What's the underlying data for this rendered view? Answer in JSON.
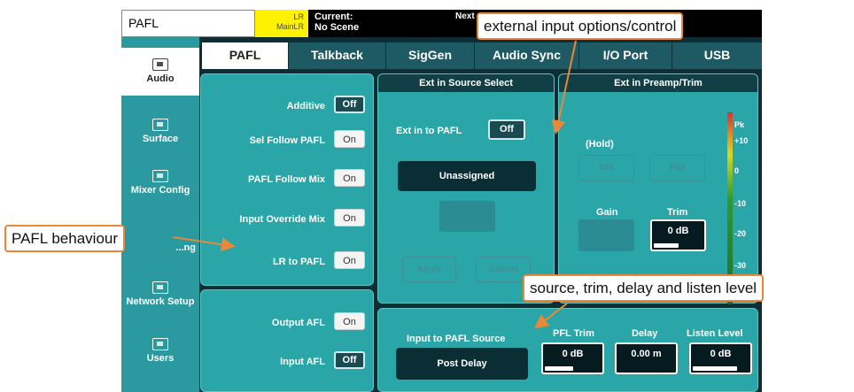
{
  "topbar": {
    "selected_name": "PAFL",
    "bus_line1": "LR",
    "bus_line2": "MainLR",
    "current_label": "Current:",
    "current_scene": "No Scene",
    "next_label": "Next"
  },
  "nav": [
    {
      "label": "Audio",
      "active": true
    },
    {
      "label": "Surface"
    },
    {
      "label": "Mixer Config"
    },
    {
      "label": "...ng"
    },
    {
      "label": "Network Setup"
    },
    {
      "label": "Users"
    }
  ],
  "tabs": [
    "PAFL",
    "Talkback",
    "SigGen",
    "Audio Sync",
    "I/O Port",
    "USB"
  ],
  "pafl_options": {
    "additive": {
      "label": "Additive",
      "value": "Off"
    },
    "sel_follow": {
      "label": "Sel Follow PAFL",
      "value": "On"
    },
    "pafl_follow_mix": {
      "label": "PAFL Follow Mix",
      "value": "On"
    },
    "input_override": {
      "label": "Input Override Mix",
      "value": "On"
    },
    "lr_to_pafl": {
      "label": "LR to PAFL",
      "value": "On"
    }
  },
  "afl_options": {
    "output_afl": {
      "label": "Output AFL",
      "value": "On"
    },
    "input_afl": {
      "label": "Input AFL",
      "value": "Off"
    }
  },
  "ext_source": {
    "title": "Ext in Source Select",
    "ext_in_label": "Ext in to PAFL",
    "ext_in_value": "Off",
    "source_value": "Unassigned",
    "apply": "Apply",
    "cancel": "Cancel"
  },
  "ext_preamp": {
    "title": "Ext in Preamp/Trim",
    "hold": "(Hold)",
    "btn1": "48V",
    "btn2": "Pad",
    "gain_label": "Gain",
    "trim_label": "Trim",
    "trim_value": "0 dB",
    "trim_fill": 0.5,
    "meter_scale": [
      "Pk",
      "+10",
      "0",
      "-10",
      "-20",
      "-30"
    ]
  },
  "bottom": {
    "source_label": "Input to PAFL Source",
    "source_value": "Post Delay",
    "pfl_trim_label": "PFL Trim",
    "pfl_trim_value": "0 dB",
    "pfl_trim_fill": 0.5,
    "delay_label": "Delay",
    "delay_value": "0.00 m",
    "delay_fill": 0.0,
    "listen_label": "Listen Level",
    "listen_value": "0 dB",
    "listen_fill": 0.8
  },
  "annotations": {
    "external": "external input options/control",
    "behaviour": "PAFL behaviour",
    "source_trim": "source, trim, delay and listen level"
  },
  "colors": {
    "panel": "#2aa6a8",
    "panel_dark": "#215c64",
    "bus_yellow": "#fff200",
    "callout_border": "#e8893a"
  }
}
